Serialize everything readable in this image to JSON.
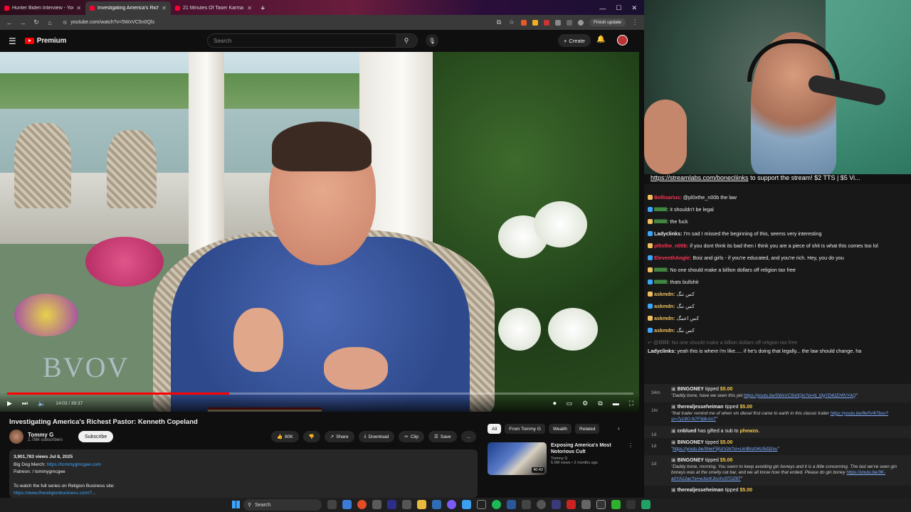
{
  "browser": {
    "tabs": [
      {
        "title": "Hunter Biden Interview - YouT",
        "active": false
      },
      {
        "title": "Investigating America's Riches",
        "active": true
      },
      {
        "title": "21 Minutes Of Taser Karma For",
        "active": false
      }
    ],
    "url": "youtube.com/watch?v=5WxVC5n0Qls",
    "finish_update": "Finish update",
    "new_tab": "+"
  },
  "youtube": {
    "logo_text": "Premium",
    "search_placeholder": "Search",
    "create_label": "Create",
    "video": {
      "watermark": "BVOV",
      "time": "14:03 / 39:37",
      "progress": 0.354
    },
    "title": "Investigating America's Richest Pastor: Kenneth Copeland",
    "channel": {
      "name": "Tommy G",
      "subs": "2.78M subscribers"
    },
    "subscribe": "Subscribe",
    "actions": {
      "likes": "80K",
      "share": "Share",
      "download": "Download",
      "clip": "Clip",
      "save": "Save",
      "more": "..."
    },
    "description": {
      "line1": "3,901,783 views  Jul 8, 2025",
      "line2_label": "Big Dog Merch: ",
      "line2_link": "https://tommygmcgee.com",
      "line3": "Patreon:  / tommygmcgee",
      "line4": "To watch the full series on Religion Business site:",
      "line5_link": "https://www.thereligionbusiness.com/?..."
    },
    "chips": [
      "All",
      "From Tommy G",
      "Wealth",
      "Related"
    ],
    "recommendation": {
      "title": "Exposing America's Most Notorious Cult",
      "channel": "Tommy G",
      "meta": "5.6M views • 2 months ago",
      "duration": "40:42"
    }
  },
  "stream": {
    "ticker_link": "https://streamlabs.com/bonecliinks",
    "ticker_text": " to support the stream! $2 TTS | $5 Vi...",
    "chat": [
      {
        "name": "Bellisarius:",
        "color": "#ff3355",
        "text": "@pl0xthe_n00b the law"
      },
      {
        "name": "lllllllll:",
        "color": "#6cf56c",
        "text": "it shouldn't be legal"
      },
      {
        "name": "lllllllll:",
        "color": "#6cf56c",
        "text": "the fuck"
      },
      {
        "name": "Ladyclinks:",
        "color": "#f0f0f0",
        "text": "I'm sad I missed the beginning of this, seems very interesting"
      },
      {
        "name": "pl0xthe_n00b:",
        "color": "#ff3355",
        "text": "if you dont think its bad then i think you are a piece of shit is what this comes too lol"
      },
      {
        "name": "EleventhAngle:",
        "color": "#ff3355",
        "text": "Boiz and girls - if you're educated, and you're rich. Hey, you do you"
      },
      {
        "name": "lllllllll:",
        "color": "#6cf56c",
        "text": "No one should make a billion dollars off religion tax free"
      },
      {
        "name": "lllllllll:",
        "color": "#6cf56c",
        "text": "thats bullshit"
      },
      {
        "name": "askmdn:",
        "color": "#f0c060",
        "text": "کس ننگ"
      },
      {
        "name": "askmdn:",
        "color": "#f0c060",
        "text": "کس ننگ"
      },
      {
        "name": "askmdn:",
        "color": "#f0c060",
        "text": "کس اعمگ"
      },
      {
        "name": "askmdn:",
        "color": "#f0c060",
        "text": "کس ننگ"
      }
    ],
    "reply_hint": "↩ @lllllllll: No one should make a billion dollars off religion tax free",
    "last_msg": {
      "name": "Ladyclinks:",
      "text": "yeah this is where i'm like..... if he's doing that legally... the law should change. ha"
    },
    "events": [
      {
        "age": "34m",
        "who": "BINGONEY",
        "verb": " tipped ",
        "amount": "$5.00",
        "quote": "\"Daddy bone, have we seen this yet ",
        "link": "https://youtu.be/5WxVC5n0Qls?si=N_l0gYD41EHfVYAQ",
        "end": "\""
      },
      {
        "age": "1hr",
        "who": "therealjesseheiman",
        "verb": " tipped ",
        "amount": "$5.00",
        "quote": "\"that trailer remind me of when vin diesel first came to earth in this classic trailer ",
        "link": "https://youtu.be/fle5V4l7bxo?si=7y19O-N7F9j9rAnT",
        "end": "\""
      },
      {
        "age": "1d",
        "who": "cnblued",
        "verb": " has gifted a sub to ",
        "amount": "phewzo.",
        "quote": "",
        "link": "",
        "end": ""
      },
      {
        "age": "1d",
        "who": "BINGONEY",
        "verb": " tipped ",
        "amount": "$5.00",
        "quote": "\"",
        "link": "https://youtu.be/9nwF9jUrVzk?si=LkrlBnz04U5d32vu",
        "end": "\""
      },
      {
        "age": "1d",
        "who": "BINGONEY",
        "verb": " tipped ",
        "amount": "$5.00",
        "quote": "\"Daddy bone, morning. You seem to keep avoiding gin boneys and it is a little concerning. The last we've seen gin boneys was at the smelly cat bar, and we all know how that ended. Please do gin boney ",
        "link": "https://youtu.be/3K-a0YA12ac?si=eJscKJcvXv3TOZ8T",
        "end": "\""
      },
      {
        "age": "",
        "who": "therealjesseheiman",
        "verb": " tipped ",
        "amount": "$5.00",
        "quote": "",
        "link": "",
        "end": ""
      }
    ]
  },
  "taskbar": {
    "search": "Search"
  }
}
